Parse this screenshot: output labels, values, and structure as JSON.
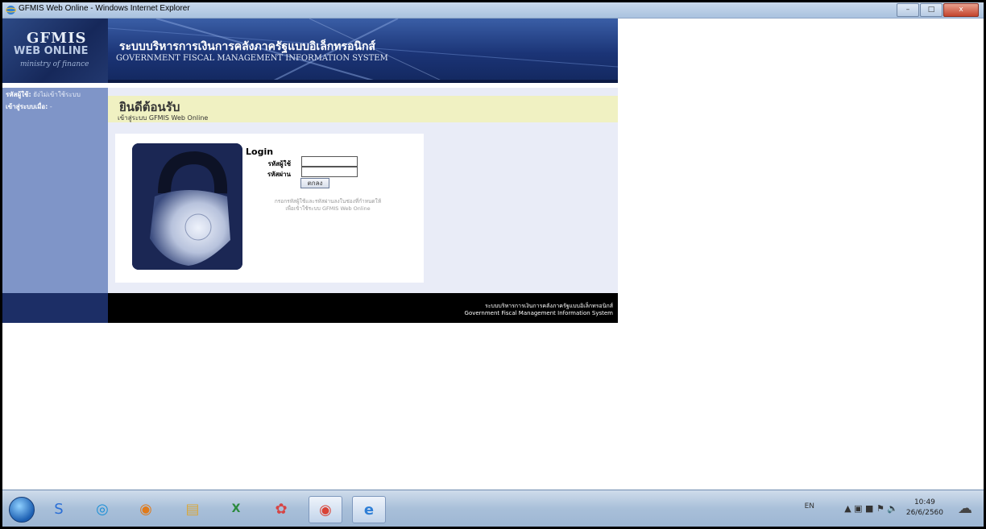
{
  "window": {
    "title": "GFMIS Web Online - Windows Internet Explorer",
    "min_label": "–",
    "max_label": "□",
    "close_label": "x"
  },
  "header": {
    "logo_top": "GFMIS",
    "logo_mid": "WEB ONLINE",
    "logo_bottom": "ministry of finance",
    "title_th": "ระบบบริหารการเงินการคลังภาครัฐแบบอิเล็กทรอนิกส์",
    "title_en": "GOVERNMENT FISCAL MANAGEMENT INFORMATION SYSTEM"
  },
  "sidebar": {
    "user_label": "รหัสผู้ใช้:",
    "user_value": "ยังไม่เข้าใช้ระบบ",
    "login_time_label": "เข้าสู่ระบบเมื่อ:",
    "login_time_value": "-"
  },
  "welcome": {
    "title": "ยินดีต้อนรับ",
    "subtitle": "เข้าสู่ระบบ GFMIS Web Online"
  },
  "login": {
    "title": "Login",
    "username_label": "รหัสผู้ใช้",
    "password_label": "รหัสผ่าน",
    "username_value": "",
    "password_value": "",
    "submit_label": "ตกลง",
    "hint_line1": "กรอกรหัสผู้ใช้และรหัสผ่านลงในช่องที่กำหนดให้",
    "hint_line2": "เพื่อเข้าใช้ระบบ GFMIS Web Online"
  },
  "footer": {
    "line_th": "ระบบบริหารการเงินการคลังภาครัฐแบบอิเล็กทรอนิกส์",
    "line_en": "Government Fiscal Management Information System"
  },
  "taskbar": {
    "apps": [
      {
        "name": "start-button-icon"
      },
      {
        "name": "app-icon"
      },
      {
        "name": "app-icon"
      },
      {
        "name": "media-icon"
      },
      {
        "name": "file-explorer-icon"
      },
      {
        "name": "excel-icon"
      },
      {
        "name": "app-icon"
      },
      {
        "name": "chrome-icon"
      },
      {
        "name": "internet-explorer-icon"
      }
    ],
    "language": "EN",
    "time": "10:49",
    "date": "26/6/2560"
  }
}
